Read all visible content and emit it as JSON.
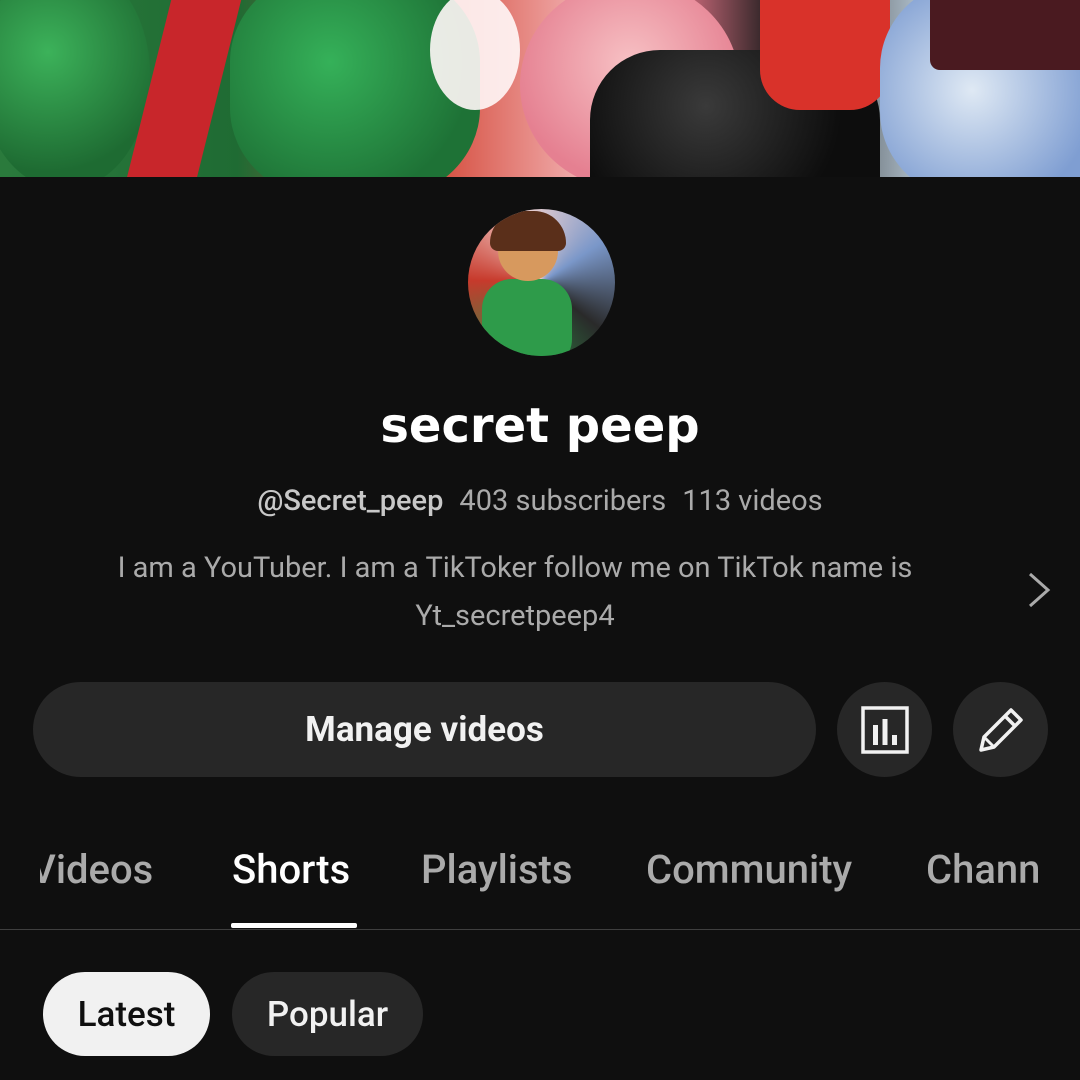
{
  "channel": {
    "name": "secret peep",
    "handle": "@Secret_peep",
    "subscribers": "403 subscribers",
    "videos": "113 videos",
    "description": "I am a YouTuber. I am a TikToker follow me on TikTok name is Yt_secretpeep4"
  },
  "actions": {
    "manage_label": "Manage videos",
    "analytics_icon": "analytics-icon",
    "edit_icon": "pencil-icon",
    "more_icon": "chevron-right-icon"
  },
  "tabs": {
    "videos": "Videos",
    "shorts": "Shorts",
    "playlists": "Playlists",
    "community": "Community",
    "channels": "Channels",
    "active": "Shorts"
  },
  "filters": {
    "latest": "Latest",
    "popular": "Popular",
    "selected": "Latest"
  },
  "colors": {
    "background": "#0f0f0f",
    "surface": "#272727",
    "text_primary": "#f1f1f1",
    "text_secondary": "#aaaaaa"
  }
}
